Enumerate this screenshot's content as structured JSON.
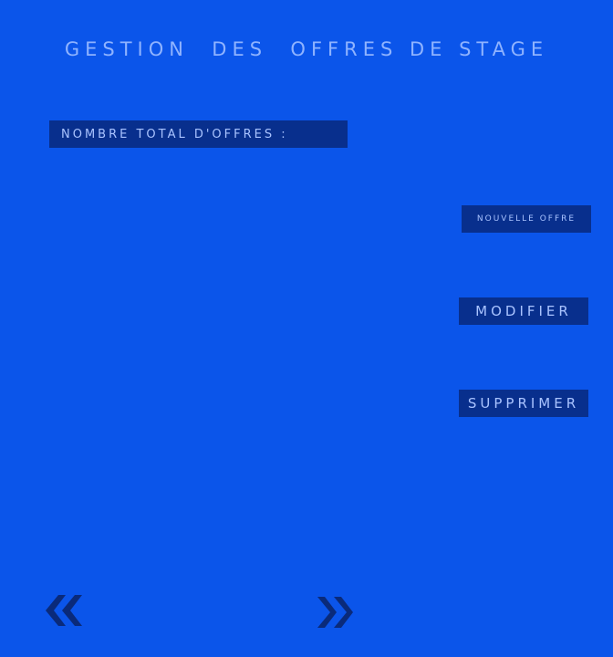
{
  "header": {
    "title": "GESTION  DES  OFFRES DE STAGE"
  },
  "summary": {
    "total_label": "NOMBRE TOTAL D'OFFRES :",
    "total_value": ""
  },
  "actions": {
    "new_label": "NOUVELLE OFFRE",
    "edit_label": "MODIFIER",
    "delete_label": "SUPPRIMER"
  },
  "pagination": {
    "prev_icon": "double-chevron-left-icon",
    "next_icon": "double-chevron-right-icon"
  },
  "colors": {
    "background": "#0b55ea",
    "panel": "#082f8d",
    "text_light": "#a9c3ff",
    "title": "#8fb3ff",
    "nav_icon": "#0a2a7a"
  }
}
